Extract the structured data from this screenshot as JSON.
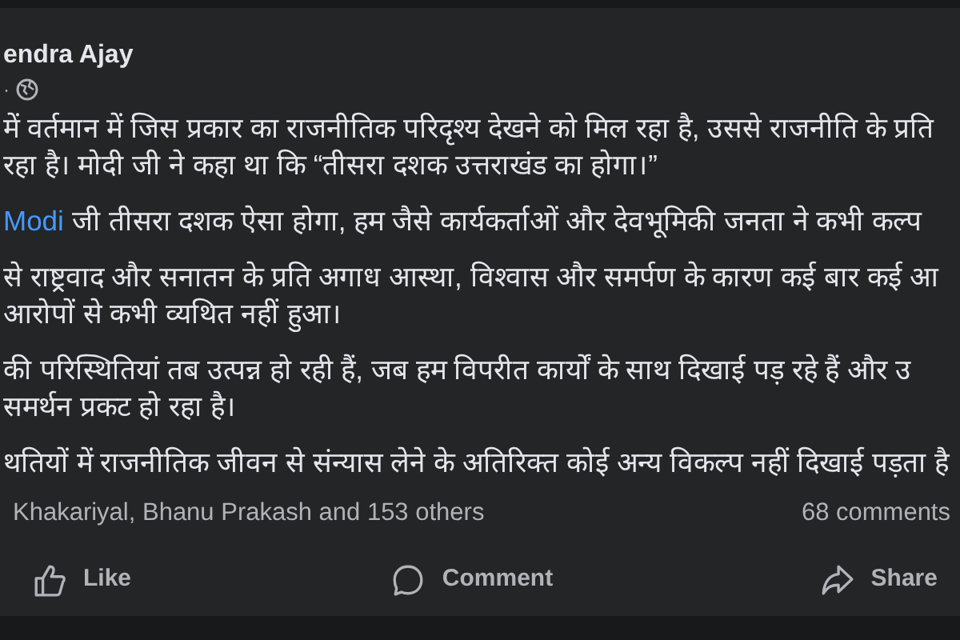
{
  "post": {
    "author": "endra Ajay",
    "meta": "·",
    "paragraphs": [
      [
        {
          "text": "में वर्तमान में जिस प्रकार का राजनीतिक परिदृश्य देखने को मिल रहा है, उससे राजनीति के प्रति"
        },
        {
          "text": "रहा है। मोदी जी ने कहा था कि “तीसरा दशक उत्तराखंड का होगा।”"
        }
      ],
      [
        {
          "link": "Modi",
          "text": "जी तीसरा दशक ऐसा होगा, हम जैसे कार्यकर्ताओं और देवभूमिकी जनता ने कभी कल्प"
        }
      ],
      [
        {
          "text": "से राष्ट्रवाद और सनातन के प्रति अगाध आस्था, विश्वास और समर्पण के कारण कई बार कई आ"
        },
        {
          "text": "आरोपों से कभी व्यथित नहीं हुआ।"
        }
      ],
      [
        {
          "text": "की परिस्थितियां तब उत्पन्न हो रही हैं, जब हम विपरीत कार्यों के साथ दिखाई पड़ रहे हैं और उ"
        },
        {
          "text": "समर्थन प्रकट हो रहा है।"
        }
      ],
      [
        {
          "text": "थतियों में राजनीतिक जीवन से संन्यास लेने के अतिरिक्त कोई अन्य विकल्प नहीं दिखाई पड़ता है"
        }
      ]
    ],
    "reactions": "Khakariyal, Bhanu Prakash and 153 others",
    "comments": "68 comments",
    "actions": [
      {
        "kind": "like",
        "label": "Like"
      },
      {
        "kind": "comment",
        "label": "Comment"
      },
      {
        "kind": "share",
        "label": "Share"
      }
    ]
  }
}
